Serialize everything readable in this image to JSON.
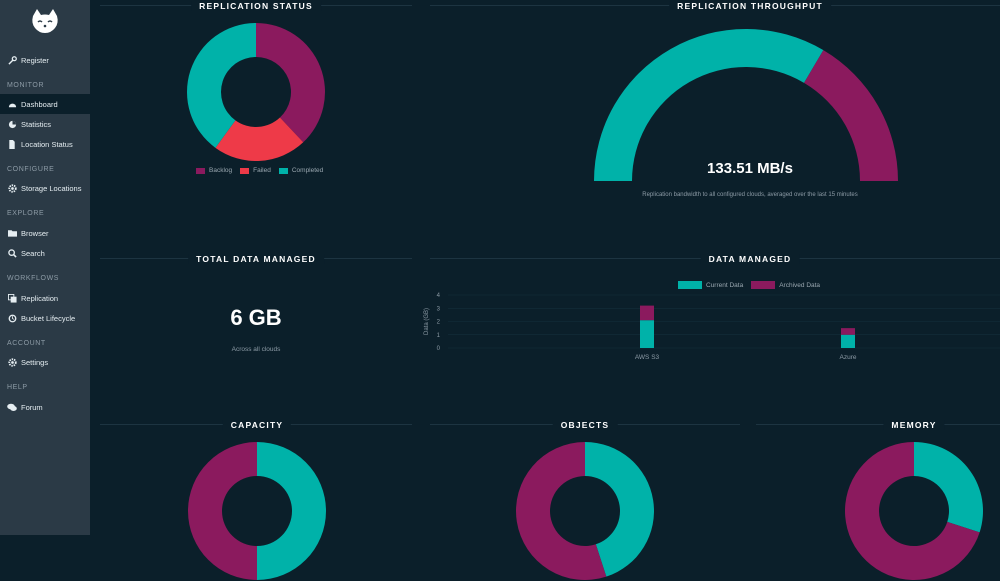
{
  "sidebar": {
    "register": "Register",
    "sections": {
      "monitor": "MONITOR",
      "configure": "CONFIGURE",
      "explore": "EXPLORE",
      "workflows": "WORKFLOWS",
      "account": "ACCOUNT",
      "help": "HELP"
    },
    "items": {
      "dashboard": "Dashboard",
      "statistics": "Statistics",
      "location_status": "Location Status",
      "storage_locations": "Storage Locations",
      "browser": "Browser",
      "search": "Search",
      "replication": "Replication",
      "bucket_lifecycle": "Bucket Lifecycle",
      "settings": "Settings",
      "forum": "Forum"
    },
    "active": "dashboard"
  },
  "colors": {
    "teal": "#00b2a9",
    "magenta": "#8b1a5e",
    "red": "#ee3a48",
    "background": "#0b1f2a",
    "sidebar": "#2b3a46"
  },
  "panels": {
    "replication_status": {
      "title": "REPLICATION STATUS",
      "legend": [
        "Backlog",
        "Failed",
        "Completed"
      ]
    },
    "replication_throughput": {
      "title": "REPLICATION THROUGHPUT",
      "value": "133.51 MB/s",
      "caption": "Replication bandwidth to all configured clouds, averaged over the last 15 minutes"
    },
    "total_data_managed": {
      "title": "TOTAL DATA MANAGED",
      "value": "6 GB",
      "caption": "Across all clouds"
    },
    "data_managed": {
      "title": "DATA MANAGED"
    },
    "capacity": {
      "title": "CAPACITY"
    },
    "objects": {
      "title": "OBJECTS"
    },
    "memory": {
      "title": "MEMORY"
    }
  },
  "chart_data": [
    {
      "type": "pie",
      "categories": [
        "Backlog",
        "Failed",
        "Completed"
      ],
      "values": [
        38,
        22,
        40
      ],
      "colors": [
        "#8b1a5e",
        "#ee3a48",
        "#00b2a9"
      ],
      "legend": "bottom"
    },
    {
      "type": "gauge",
      "value_fraction": 0.67,
      "colors": [
        "#00b2a9",
        "#8b1a5e"
      ]
    },
    {
      "type": "bar",
      "categories": [
        "AWS S3",
        "Azure",
        "Zenko"
      ],
      "series": [
        {
          "name": "Current Data",
          "values": [
            2.1,
            1.0,
            1.0
          ]
        },
        {
          "name": "Archived Data",
          "values": [
            1.1,
            0.5,
            0.5
          ]
        }
      ],
      "ylabel": "Data (GB)",
      "ylim": [
        0,
        4
      ],
      "yticks": [
        "0",
        "1",
        "2",
        "3",
        "4"
      ],
      "stacked": true,
      "legend": "top",
      "colors": [
        "#00b2a9",
        "#8b1a5e"
      ]
    },
    {
      "type": "pie",
      "values": [
        50,
        50
      ],
      "colors": [
        "#00b2a9",
        "#8b1a5e"
      ]
    },
    {
      "type": "pie",
      "values": [
        45,
        55
      ],
      "colors": [
        "#00b2a9",
        "#8b1a5e"
      ]
    },
    {
      "type": "pie",
      "values": [
        30,
        70
      ],
      "colors": [
        "#00b2a9",
        "#8b1a5e"
      ]
    }
  ]
}
